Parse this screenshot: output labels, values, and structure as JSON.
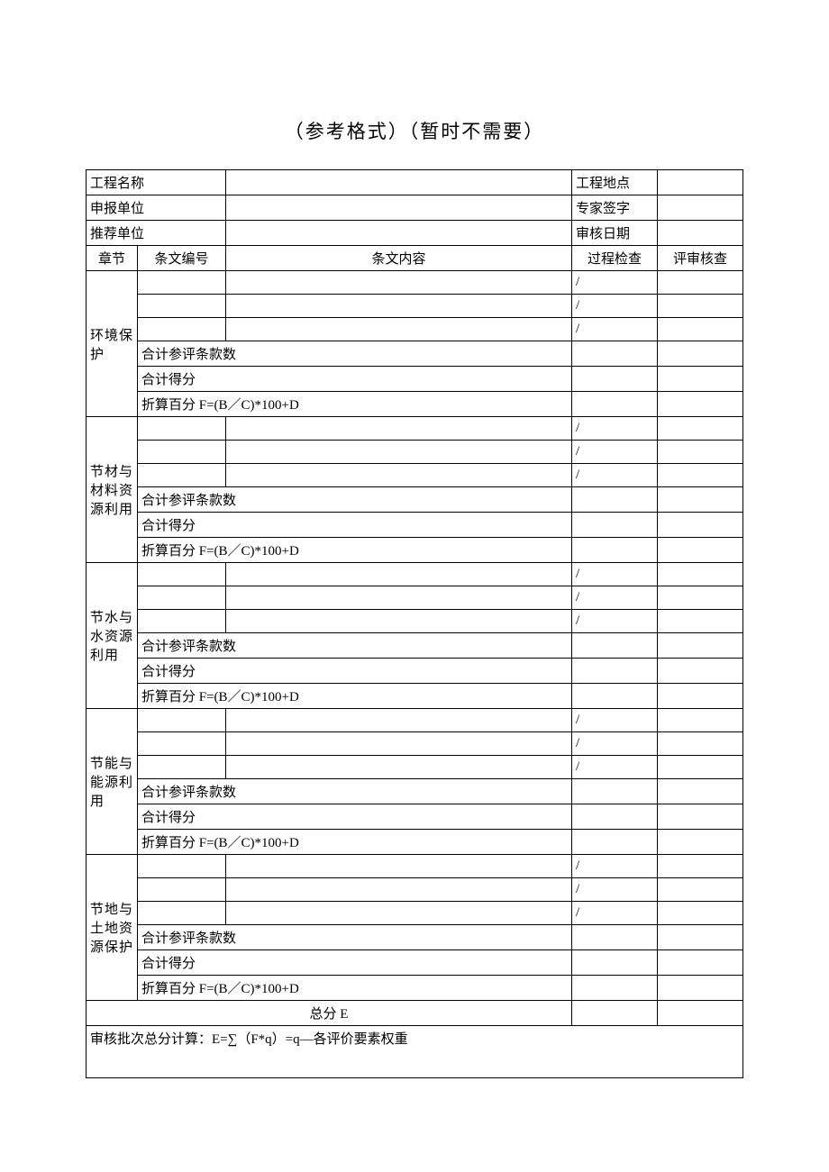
{
  "title": "（参考格式）（暂时不需要）",
  "header_rows": [
    {
      "left_label": "工程名称",
      "right_label": "工程地点"
    },
    {
      "left_label": "申报单位",
      "right_label": "专家签字"
    },
    {
      "left_label": "推荐单位",
      "right_label": "审核日期"
    }
  ],
  "column_headers": {
    "section": "章节",
    "code": "条文编号",
    "content": "条文内容",
    "process": "过程检查",
    "review": "评审核查"
  },
  "sections": [
    {
      "name": "环境保护"
    },
    {
      "name": "节材与材料资源利用"
    },
    {
      "name": "节水与水资源利用"
    },
    {
      "name": "节能与能源利用"
    },
    {
      "name": "节地与土地资源保护"
    }
  ],
  "slash": "/",
  "row_labels": {
    "total_items": "合计参评条款数",
    "total_score": "合计得分",
    "formula": "折算百分 F=(B／C)*100+D"
  },
  "total_e": "总分 E",
  "bottom_formula": "审核批次总分计算：E=∑（F*q）=q—各评价要素权重"
}
